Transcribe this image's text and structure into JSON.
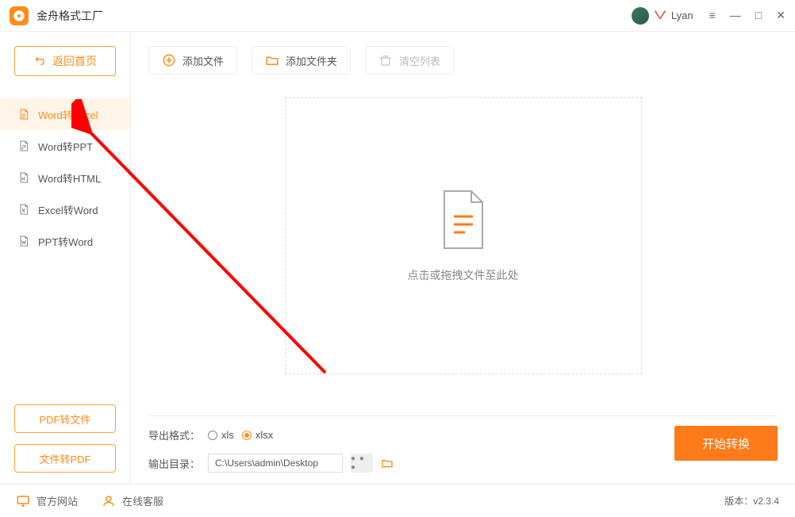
{
  "app": {
    "title": "金舟格式工厂"
  },
  "user": {
    "name": "Lyan"
  },
  "sidebar": {
    "back_label": "返回首页",
    "items": [
      {
        "label": "Word转Excel"
      },
      {
        "label": "Word转PPT"
      },
      {
        "label": "Word转HTML"
      },
      {
        "label": "Excel转Word"
      },
      {
        "label": "PPT转Word"
      }
    ],
    "pdf_to_file": "PDF转文件",
    "file_to_pdf": "文件转PDF"
  },
  "toolbar": {
    "add_file": "添加文件",
    "add_folder": "添加文件夹",
    "clear_list": "清空列表"
  },
  "dropzone": {
    "hint": "点击或拖拽文件至此处"
  },
  "export": {
    "format_label": "导出格式：",
    "opt_xls": "xls",
    "opt_xlsx": "xlsx",
    "dir_label": "输出目录：",
    "dir_path": "C:\\Users\\admin\\Desktop"
  },
  "actions": {
    "start": "开始转换"
  },
  "footer": {
    "official_site": "官方网站",
    "online_service": "在线客服",
    "version_label": "版本：",
    "version": "v2.3.4"
  }
}
